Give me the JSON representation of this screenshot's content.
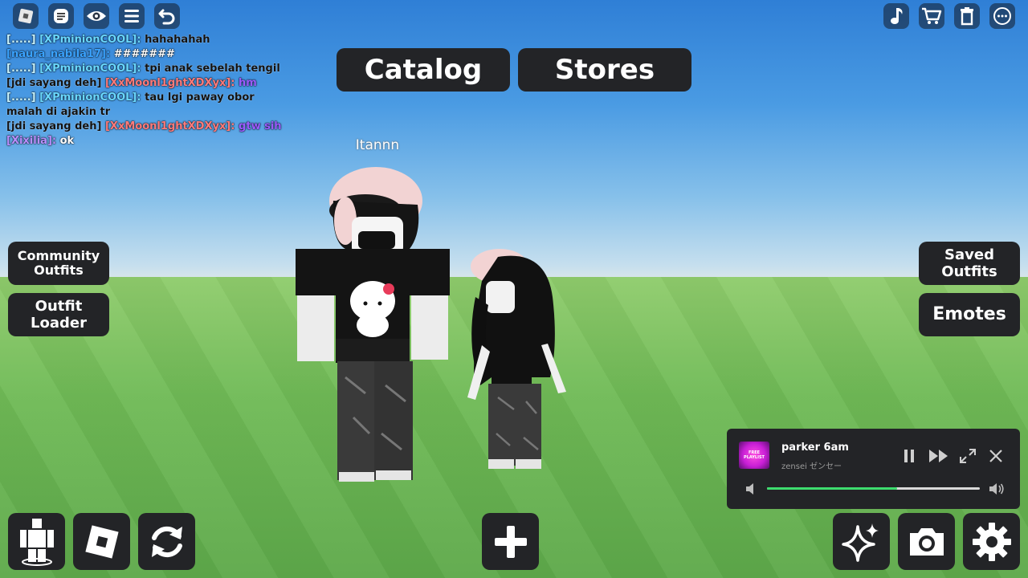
{
  "top_left_buttons": [
    "roblox-menu-icon",
    "chat-icon",
    "eye-icon",
    "list-icon",
    "undo-icon"
  ],
  "top_right_buttons": [
    "music-note-icon",
    "cart-icon",
    "trash-icon",
    "more-icon"
  ],
  "chat": [
    {
      "tag": "[.....]",
      "user": "[XPminionCOOL]:",
      "user_color": "#6ad8ff",
      "msg": "hahahahah",
      "msg_color": "#111111"
    },
    {
      "tag": "",
      "user": "[naura_nabila17]:",
      "user_color": "#3aa3ff",
      "msg": "#######",
      "msg_color": "#ffffff"
    },
    {
      "tag": "[.....]",
      "user": "[XPminionCOOL]:",
      "user_color": "#6ad8ff",
      "msg": "tpi anak sebelah tengil",
      "msg_color": "#111111"
    },
    {
      "tag": "[jdi sayang deh]",
      "user": "[XxMoonl1ghtXDXyx]:",
      "user_color": "#ff7b7b",
      "msg": "hm",
      "msg_color": "#9b5cff"
    },
    {
      "tag": "[.....]",
      "user": "[XPminionCOOL]:",
      "user_color": "#6ad8ff",
      "msg": "tau lgi paway obor malah di ajakin tr",
      "msg_color": "#111111"
    },
    {
      "tag": "[jdi sayang deh]",
      "user": "[XxMoonl1ghtXDXyx]:",
      "user_color": "#ff7b7b",
      "msg": "gtw sih",
      "msg_color": "#9b5cff"
    },
    {
      "tag": "",
      "user": "[Xixilia]:",
      "user_color": "#b98fff",
      "msg": "ok",
      "msg_color": "#ffffff"
    }
  ],
  "tabs": {
    "catalog": "Catalog",
    "stores": "Stores"
  },
  "player_name": "Itannn",
  "left_buttons": {
    "community_outfits_1": "Community",
    "community_outfits_2": "Outfits",
    "outfit_loader_1": "Outfit",
    "outfit_loader_2": "Loader"
  },
  "right_buttons": {
    "saved_outfits_1": "Saved",
    "saved_outfits_2": "Outfits",
    "emotes": "Emotes"
  },
  "music": {
    "title": "parker 6am",
    "artist": "zensei ゼンセー",
    "cover_text": "FREE PLAYLIST",
    "progress": 0.61,
    "accent": "#3ddc6e"
  },
  "colors": {
    "button_bg": "#232427",
    "sky_top": "#2f7fd6",
    "ground": "#6db554"
  }
}
